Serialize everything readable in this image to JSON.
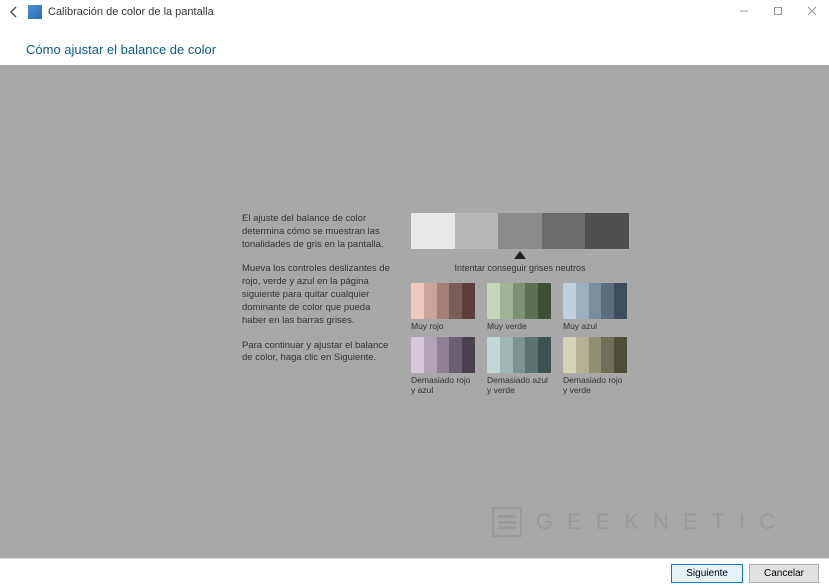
{
  "window": {
    "title": "Calibración de color de la pantalla",
    "heading": "Cómo ajustar el balance de color"
  },
  "instructions": {
    "p1": "El ajuste del balance de color determina cómo se muestran las tonalidades de gris en la pantalla.",
    "p2": "Mueva los controles deslizantes de rojo, verde y azul en la página siguiente para quitar cualquier dominante de color que pueda haber en las barras grises.",
    "p3": "Para continuar y ajustar el balance de color, haga clic en Siguiente."
  },
  "top_strip": {
    "pointer_label": "Intentar conseguir grises neutros",
    "segments": [
      "#e8e8e8",
      "#b8b8b8",
      "#8a8a8a",
      "#6c6c6c",
      "#4f4f4f"
    ]
  },
  "swatches": [
    {
      "label": "Muy rojo",
      "bars": [
        "#efc8c0",
        "#caa39c",
        "#a47f7a",
        "#7c5c58",
        "#5a3f3c"
      ]
    },
    {
      "label": "Muy verde",
      "bars": [
        "#c6d6bb",
        "#a2b497",
        "#7f9175",
        "#5d6f55",
        "#3f4e39"
      ]
    },
    {
      "label": "Muy azul",
      "bars": [
        "#c2d0dd",
        "#9fafbf",
        "#7c8da0",
        "#5b6c7f",
        "#3e4c5c"
      ]
    },
    {
      "label": "Demasiado rojo y azul",
      "bars": [
        "#d7c8da",
        "#b3a3b7",
        "#8f8094",
        "#6b5e70",
        "#4b414e"
      ]
    },
    {
      "label": "Demasiado azul y verde",
      "bars": [
        "#c3d8d6",
        "#9eb7b4",
        "#7b9492",
        "#5a7270",
        "#3d5250"
      ]
    },
    {
      "label": "Demasiado rojo y verde",
      "bars": [
        "#d6d4b6",
        "#b4b195",
        "#919075",
        "#6f6e58",
        "#4e4d3c"
      ]
    }
  ],
  "footer": {
    "next": "Siguiente",
    "cancel": "Cancelar"
  },
  "watermark": "GEEKNETIC"
}
